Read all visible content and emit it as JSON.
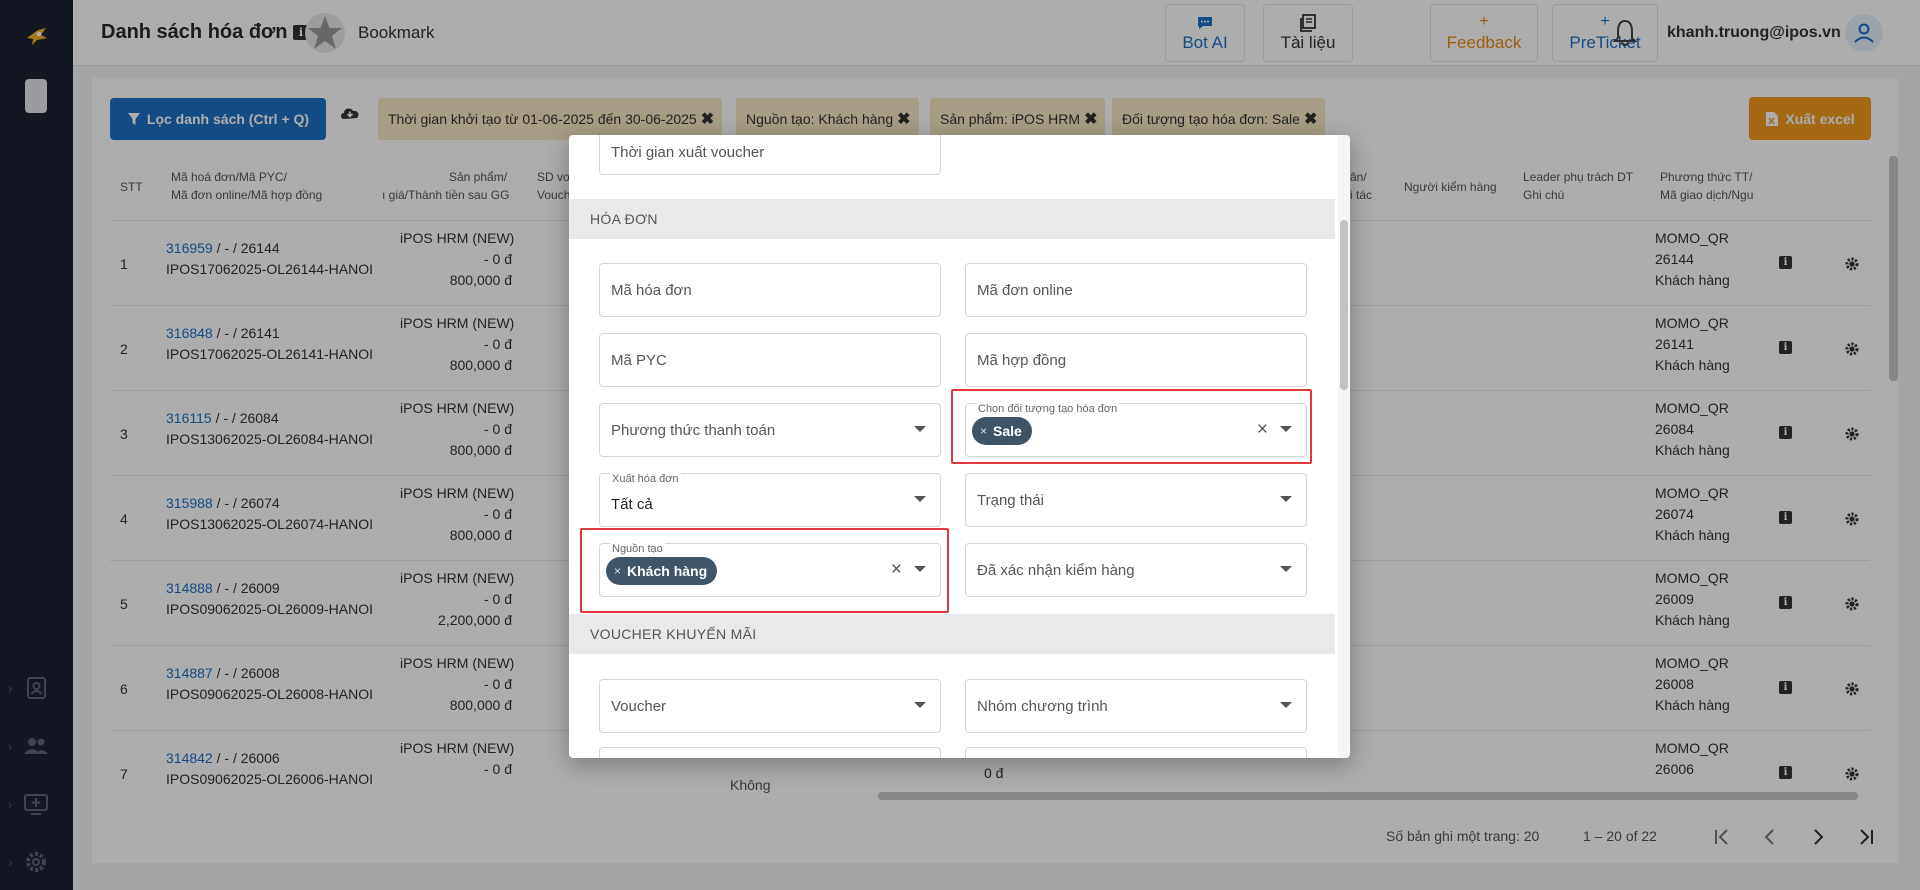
{
  "header": {
    "title": "Danh sách hóa đơn",
    "info_glyph": "i",
    "bookmark_label": "Bookmark",
    "buttons": [
      {
        "icon": "chat-bubble-icon",
        "label": "Bot AI"
      },
      {
        "icon": "document-icon",
        "label": "Tài liệu"
      },
      {
        "icon": "plus-icon",
        "label": "Feedback"
      },
      {
        "icon": "plus-icon",
        "label": "PreTicket"
      }
    ],
    "plus_glyph": "+",
    "user_email": "khanh.truong@ipos.vn"
  },
  "toolbar": {
    "filter_button": "Lọc danh sách (Ctrl + Q)",
    "export_button": "Xuất excel",
    "chip_close_glyph": "✖",
    "chips": [
      "Thời gian khởi tạo từ 01-06-2025 đến 30-06-2025",
      "Nguồn tạo: Khách hàng",
      "Sản phẩm: iPOS HRM",
      "Đối tượng tạo hóa đơn: Sale"
    ]
  },
  "table": {
    "headers": {
      "stt": "STT",
      "code_1": "Mã hoá đơn/Mã PYC/",
      "code_2": "Mã đơn online/Mã hợp đồng",
      "product_1": "Sản phẩm/",
      "product_2": "ı giá/Thành tiền sau GG",
      "voucher_1": "SD vo",
      "voucher_2": "Vouch",
      "partner_1": "ân/",
      "partner_2": "i tác",
      "checker": "Người kiểm hàng",
      "leader_1": "Leader phụ trách DT",
      "leader_2": "Ghi chú",
      "payment_1": "Phương thức TT/",
      "payment_2": "Mã giao dịch/Ngu"
    },
    "rows": [
      {
        "stt": "1",
        "invoice": "316959",
        "codes_rest": " / - / 26144",
        "order": "IPOS17062025-OL26144-HANOI",
        "product": "iPOS HRM (NEW)",
        "discount": "- 0 đ",
        "total": "800,000 đ",
        "pay_method": "MOMO_QR",
        "pay_code": "26144",
        "pay_source": "Khách hàng"
      },
      {
        "stt": "2",
        "invoice": "316848",
        "codes_rest": " / - / 26141",
        "order": "IPOS17062025-OL26141-HANOI",
        "product": "iPOS HRM (NEW)",
        "discount": "- 0 đ",
        "total": "800,000 đ",
        "pay_method": "MOMO_QR",
        "pay_code": "26141",
        "pay_source": "Khách hàng"
      },
      {
        "stt": "3",
        "invoice": "316115",
        "codes_rest": " / - / 26084",
        "order": "IPOS13062025-OL26084-HANOI",
        "product": "iPOS HRM (NEW)",
        "discount": "- 0 đ",
        "total": "800,000 đ",
        "pay_method": "MOMO_QR",
        "pay_code": "26084",
        "pay_source": "Khách hàng"
      },
      {
        "stt": "4",
        "invoice": "315988",
        "codes_rest": " / - / 26074",
        "order": "IPOS13062025-OL26074-HANOI",
        "product": "iPOS HRM (NEW)",
        "discount": "- 0 đ",
        "total": "800,000 đ",
        "pay_method": "MOMO_QR",
        "pay_code": "26074",
        "pay_source": "Khách hàng"
      },
      {
        "stt": "5",
        "invoice": "314888",
        "codes_rest": " / - / 26009",
        "order": "IPOS09062025-OL26009-HANOI",
        "product": "iPOS HRM (NEW)",
        "discount": "- 0 đ",
        "total": "2,200,000 đ",
        "pay_method": "MOMO_QR",
        "pay_code": "26009",
        "pay_source": "Khách hàng"
      },
      {
        "stt": "6",
        "invoice": "314887",
        "codes_rest": " / - / 26008",
        "order": "IPOS09062025-OL26008-HANOI",
        "product": "iPOS HRM (NEW)",
        "discount": "- 0 đ",
        "total": "800,000 đ",
        "pay_method": "MOMO_QR",
        "pay_code": "26008",
        "pay_source": "Khách hàng"
      },
      {
        "stt": "7",
        "invoice": "314842",
        "codes_rest": " / - / 26006",
        "order": "IPOS09062025-OL26006-HANOI",
        "product": "iPOS HRM (NEW)",
        "discount": "- 0 đ",
        "total": "",
        "pay_method": "MOMO_QR",
        "pay_code": "26006",
        "pay_source": ""
      }
    ],
    "partial_row7": {
      "checkbox_label": "Không",
      "amount": "0 đ",
      "checkbox_label_2": "Không"
    }
  },
  "pagination": {
    "page_size_label": "Số bản ghi một trang: 20",
    "range": "1 – 20 of 22"
  },
  "modal": {
    "voucher_time_placeholder": "Thời gian xuất voucher",
    "section_invoice": "HÓA ĐƠN",
    "section_voucher": "VOUCHER KHUYẾN MÃI",
    "invoice_code": "Mã hóa đơn",
    "online_code": "Mã đơn online",
    "pyc_code": "Mã PYC",
    "contract_code": "Mã hợp đồng",
    "payment_method": "Phương thức thanh toán",
    "creator_target_label": "Chọn đối tượng tạo hóa đơn",
    "creator_target_tag": "Sale",
    "export_invoice_label": "Xuất hóa đơn",
    "export_invoice_value": "Tất cả",
    "status": "Trạng thái",
    "source_label": "Nguồn tạo",
    "source_tag": "Khách hàng",
    "inspection": "Đã xác nhận kiểm hàng",
    "voucher": "Voucher",
    "program_group": "Nhóm chương trình",
    "tag_remove_glyph": "×",
    "clear_glyph": "×"
  },
  "colors": {
    "primary": "#1d6fc4",
    "accent": "#f39a1f",
    "sidebar": "#1c2233",
    "chip": "#f7e8c6",
    "highlight": "#e0383b",
    "tag": "#3f5567"
  }
}
